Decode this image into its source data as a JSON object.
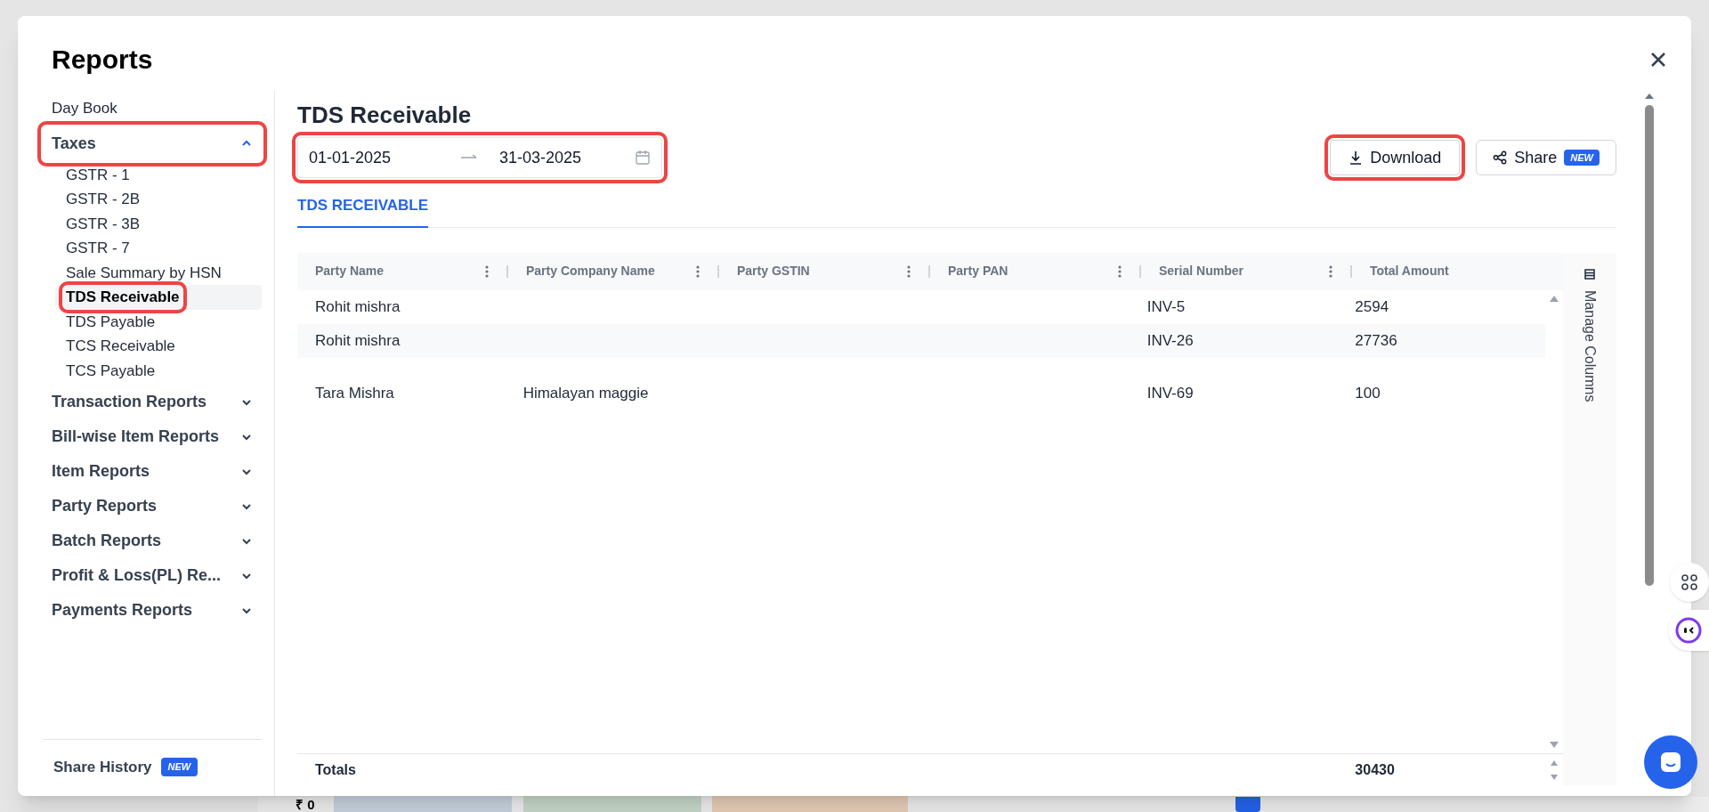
{
  "dialog": {
    "title": "Reports"
  },
  "sidebar": {
    "items": [
      {
        "label": "Day Book",
        "kind": "link",
        "highlighted": false
      },
      {
        "label": "Taxes",
        "kind": "group",
        "expanded": true,
        "highlighted": true,
        "children": [
          {
            "label": "GSTR - 1",
            "selected": false,
            "highlighted": false
          },
          {
            "label": "GSTR - 2B",
            "selected": false,
            "highlighted": false
          },
          {
            "label": "GSTR - 3B",
            "selected": false,
            "highlighted": false
          },
          {
            "label": "GSTR - 7",
            "selected": false,
            "highlighted": false
          },
          {
            "label": "Sale Summary by HSN",
            "selected": false,
            "highlighted": false
          },
          {
            "label": "TDS Receivable",
            "selected": true,
            "highlighted": true
          },
          {
            "label": "TDS Payable",
            "selected": false,
            "highlighted": false
          },
          {
            "label": "TCS Receivable",
            "selected": false,
            "highlighted": false
          },
          {
            "label": "TCS Payable",
            "selected": false,
            "highlighted": false
          }
        ]
      },
      {
        "label": "Transaction Reports",
        "kind": "group",
        "expanded": false,
        "highlighted": false
      },
      {
        "label": "Bill-wise Item Reports",
        "kind": "group",
        "expanded": false,
        "highlighted": false
      },
      {
        "label": "Item Reports",
        "kind": "group",
        "expanded": false,
        "highlighted": false
      },
      {
        "label": "Party Reports",
        "kind": "group",
        "expanded": false,
        "highlighted": false
      },
      {
        "label": "Batch Reports",
        "kind": "group",
        "expanded": false,
        "highlighted": false
      },
      {
        "label": "Profit & Loss(PL) Re...",
        "kind": "group",
        "expanded": false,
        "highlighted": false
      },
      {
        "label": "Payments Reports",
        "kind": "group",
        "expanded": false,
        "highlighted": false
      }
    ],
    "footer": {
      "label": "Share History",
      "badge": "NEW"
    }
  },
  "report": {
    "title": "TDS Receivable",
    "date_range": {
      "start": "01-01-2025",
      "end": "31-03-2025",
      "highlighted": true
    },
    "download": {
      "label": "Download",
      "highlighted": true
    },
    "share": {
      "label": "Share",
      "badge": "NEW",
      "highlighted": false
    },
    "tabs": [
      {
        "label": "TDS RECEIVABLE",
        "selected": true
      }
    ],
    "table": {
      "columns": [
        "Party Name",
        "Party Company Name",
        "Party GSTIN",
        "Party PAN",
        "Serial Number",
        "Total Amount"
      ],
      "rows": [
        [
          "Rohit mishra",
          "",
          "",
          "",
          "INV-5",
          "2594"
        ],
        [
          "Rohit mishra",
          "",
          "",
          "",
          "INV-26",
          "27736"
        ],
        [
          "Tara Mishra",
          "Himalayan maggie",
          "",
          "",
          "INV-69",
          "100"
        ]
      ],
      "totals": {
        "label": "Totals",
        "total_amount": "30430"
      }
    },
    "manage_columns": "Manage Columns"
  },
  "background": {
    "amount": "₹ 0"
  }
}
